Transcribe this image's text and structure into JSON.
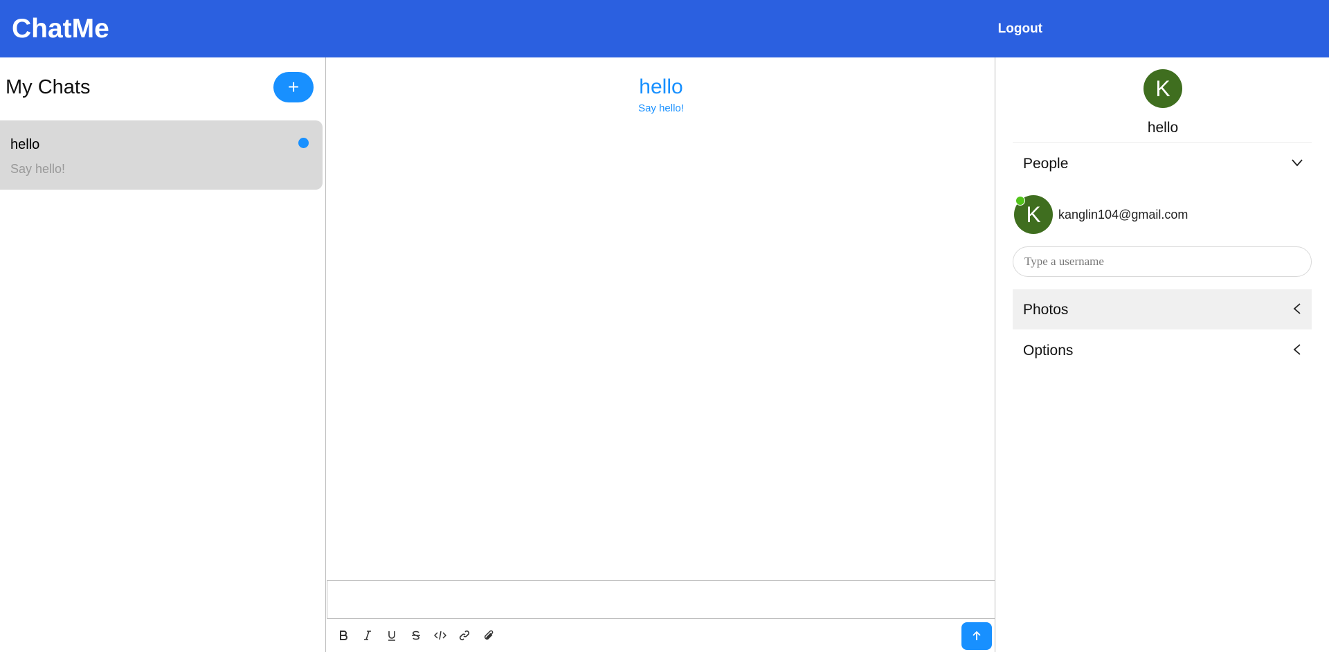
{
  "header": {
    "brand": "ChatMe",
    "logout_label": "Logout"
  },
  "sidebar": {
    "title": "My Chats",
    "new_chat_label": "+",
    "chats": [
      {
        "title": "hello",
        "last_message": "Say hello!",
        "unread": true
      }
    ]
  },
  "feed": {
    "title": "hello",
    "subtitle": "Say hello!",
    "toolbar": [
      "bold-icon",
      "italic-icon",
      "underline-icon",
      "strikethrough-icon",
      "code-icon",
      "link-icon",
      "attachment-icon"
    ]
  },
  "settings": {
    "avatar_initial": "K",
    "title": "hello",
    "people": {
      "label": "People",
      "members": [
        {
          "initial": "K",
          "email": "kanglin104@gmail.com",
          "online": true
        }
      ],
      "input_placeholder": "Type a username"
    },
    "photos_label": "Photos",
    "options_label": "Options"
  },
  "colors": {
    "header_bg": "#2b60e0",
    "accent": "#1890ff",
    "avatar_bg": "#3f6e1f",
    "online": "#52c41a",
    "active_chat_bg": "#d9d9d9"
  }
}
